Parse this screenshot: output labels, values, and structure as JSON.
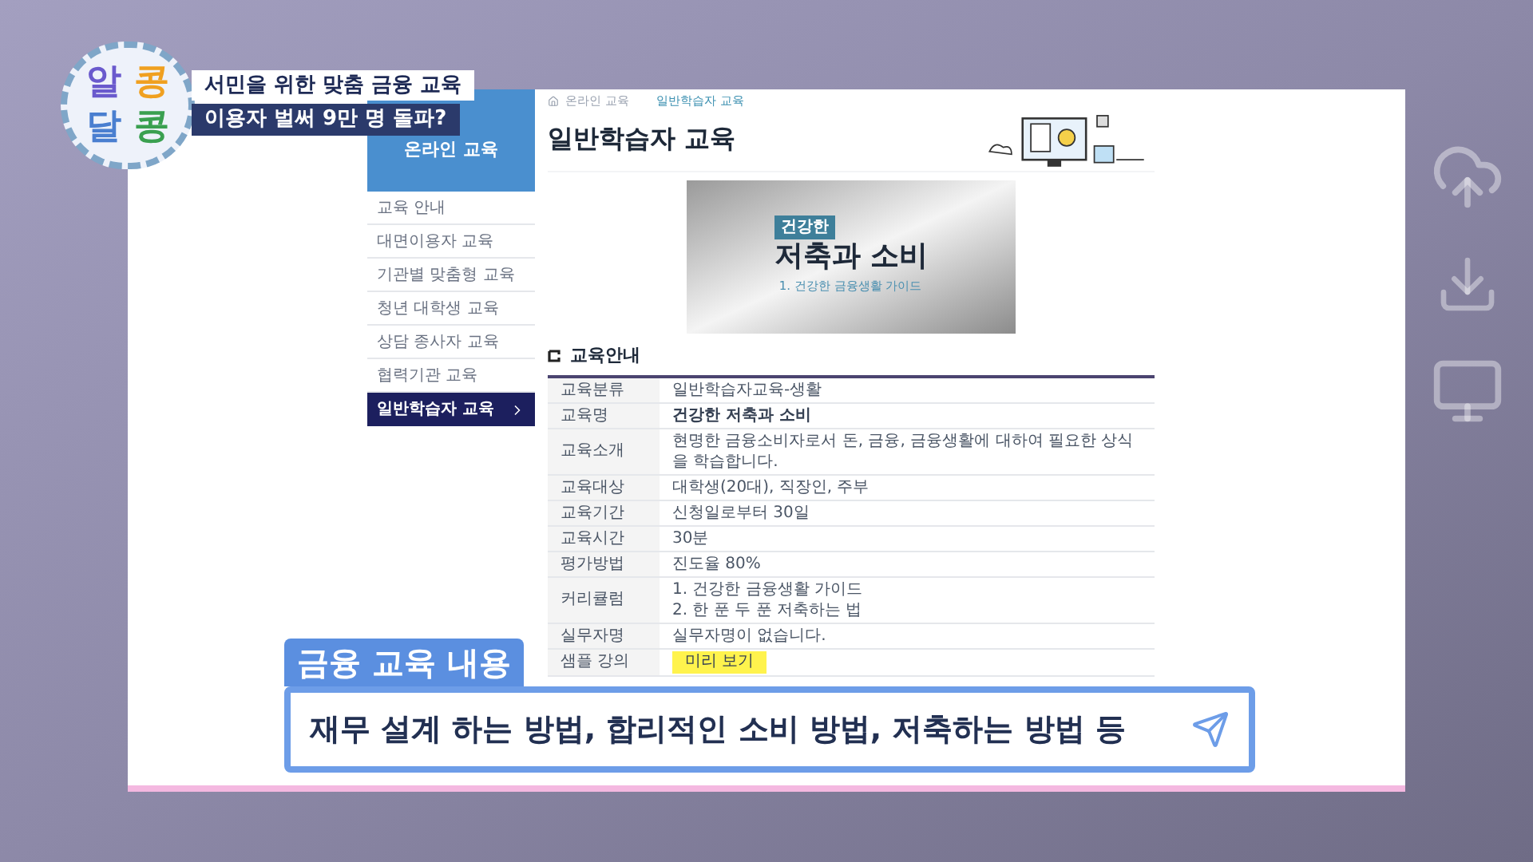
{
  "logo": {
    "letters": [
      {
        "char": "알",
        "color": "#6a5acd"
      },
      {
        "char": "콩",
        "color": "#f0a020"
      },
      {
        "char": "달",
        "color": "#4a7fd0"
      },
      {
        "char": "콩",
        "color": "#3aa050"
      }
    ]
  },
  "captions": {
    "headline": "서민을 위한 맞춤 금융 교육",
    "subheadline": "이용자 벌써 9만 명 돌파?",
    "topic_label": "금융 교육 내용",
    "topic_text": "재무 설계 하는 방법, 합리적인 소비 방법, 저축하는 방법 등"
  },
  "sidebar": {
    "title": "온라인 교육",
    "items": [
      {
        "label": "교육 안내",
        "selected": false
      },
      {
        "label": "대면이용자 교육",
        "selected": false
      },
      {
        "label": "기관별 맞춤형 교육",
        "selected": false
      },
      {
        "label": "청년 대학생 교육",
        "selected": false
      },
      {
        "label": "상담 종사자 교육",
        "selected": false
      },
      {
        "label": "협력기관 교육",
        "selected": false
      },
      {
        "label": "일반학습자 교육",
        "selected": true
      }
    ]
  },
  "breadcrumb": [
    "온라인 교육",
    "일반학습자 교육"
  ],
  "page_title": "일반학습자 교육",
  "banner": {
    "tag": "건강한",
    "title": "저축과 소비",
    "subtitle": "1. 건강한 금융생활 가이드"
  },
  "section_title": "교육안내",
  "table": {
    "rows": [
      {
        "label": "교육분류",
        "kind": "text",
        "value": "일반학습자교육-생활"
      },
      {
        "label": "교육명",
        "kind": "bold",
        "value": "건강한 저축과 소비"
      },
      {
        "label": "교육소개",
        "kind": "text",
        "value": "현명한 금융소비자로서 돈, 금융, 금융생활에 대하여 필요한 상식을 학습합니다."
      },
      {
        "label": "교육대상",
        "kind": "text",
        "value": "대학생(20대), 직장인, 주부"
      },
      {
        "label": "교육기간",
        "kind": "text",
        "value": "신청일로부터 30일"
      },
      {
        "label": "교육시간",
        "kind": "text",
        "value": "30분"
      },
      {
        "label": "평가방법",
        "kind": "text",
        "value": "진도율 80%"
      },
      {
        "label": "커리큘럼",
        "kind": "lines",
        "lines": [
          "1. 건강한 금융생활 가이드",
          "2. 한 푼 두 푼 저축하는 법"
        ]
      },
      {
        "label": "실무자명",
        "kind": "text",
        "value": "실무자명이 없습니다."
      },
      {
        "label": "샘플 강의",
        "kind": "button",
        "value": "미리 보기"
      }
    ]
  }
}
